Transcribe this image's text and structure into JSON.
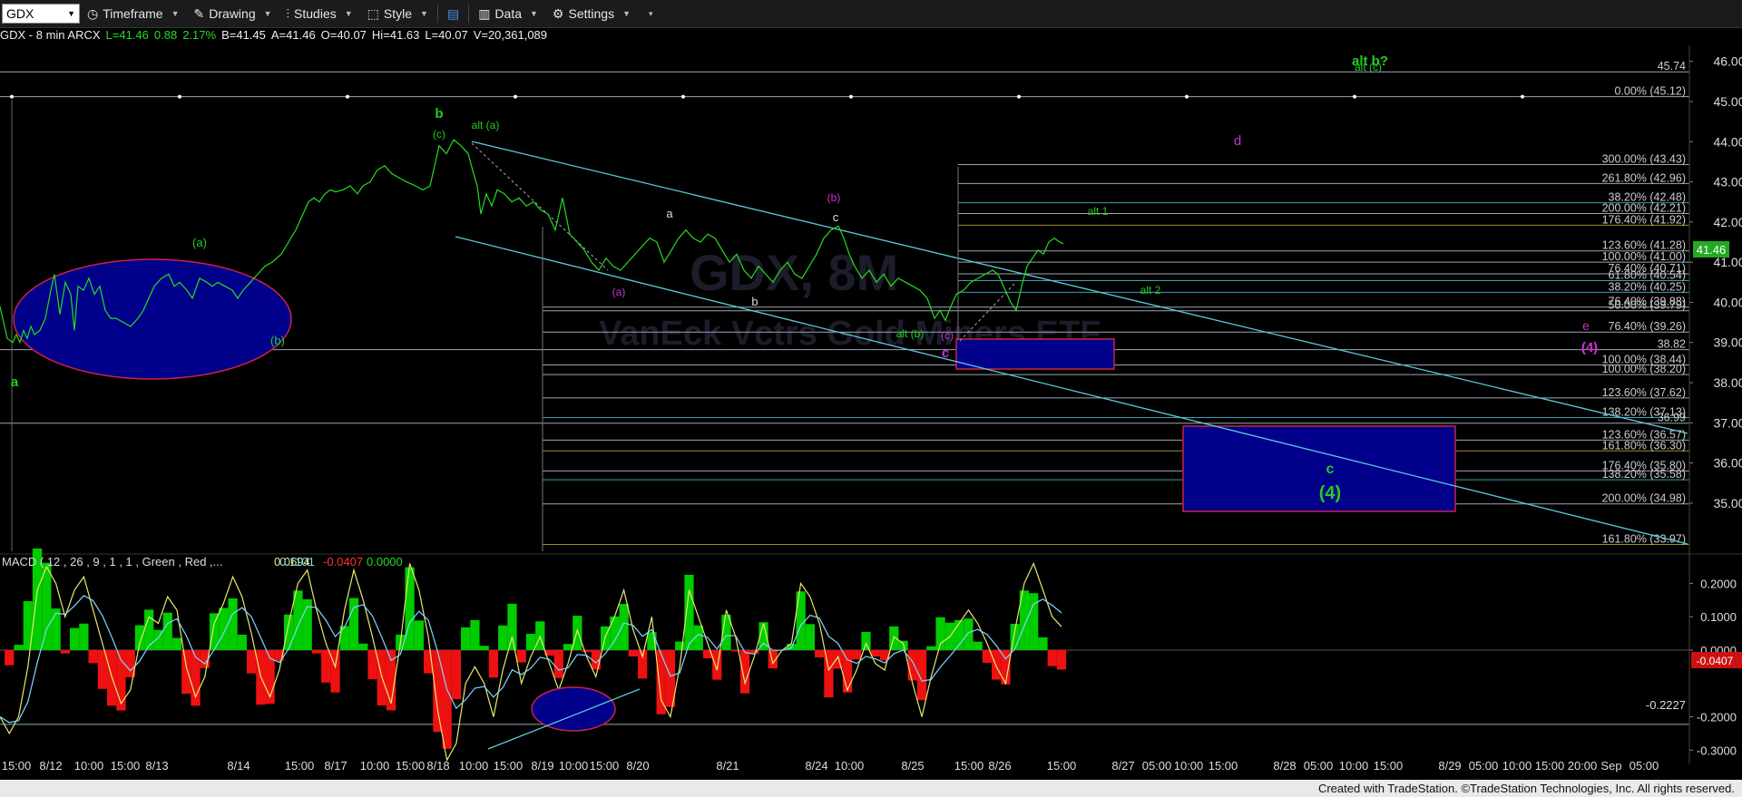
{
  "toolbar": {
    "symbol": "GDX",
    "timeframe_label": "Timeframe",
    "drawing_label": "Drawing",
    "studies_label": "Studies",
    "style_label": "Style",
    "data_label": "Data",
    "settings_label": "Settings"
  },
  "infobar": {
    "title": "GDX - 8 min ARCX",
    "last": "L=41.46",
    "change": "0.88",
    "pct": "2.17%",
    "bid": "B=41.45",
    "ask": "A=41.46",
    "open": "O=40.07",
    "high": "Hi=41.63",
    "low": "L=40.07",
    "volume": "V=20,361,089"
  },
  "macd_header": {
    "label": "MACD ( 12 , 26 , 9 , 1 , 1 , Green , Red ,...",
    "v1": "0.0694",
    "v2": "0.1101",
    "v3": "-0.0407",
    "v4": "0.0000"
  },
  "watermark": {
    "symbol": "GDX, 8M",
    "name": "VanEck Vctrs Gold Miners ETF"
  },
  "footer": "Created with TradeStation. ©TradeStation Technologies, Inc. All rights reserved.",
  "colors": {
    "price": "#22dd22",
    "green_label": "#22cc22",
    "magenta": "#cc33cc",
    "channel": "#5fc8dc",
    "box_fill": "#00008b",
    "box_border": "#cc2244",
    "macd_pos": "#00dd00",
    "macd_neg": "#ee1111",
    "macd_line": "#e8e870",
    "signal_line": "#7fd7ff"
  },
  "chart_data": [
    {
      "type": "line",
      "subtype": "candlestick-price",
      "symbol": "GDX",
      "interval": "8 min",
      "ylim": [
        33.8,
        46.4
      ],
      "y_ticks": [
        35.0,
        36.0,
        37.0,
        38.0,
        39.0,
        40.0,
        41.0,
        42.0,
        43.0,
        44.0,
        45.0,
        46.0
      ],
      "y_tick_labels": [
        "35.00",
        "36.00",
        "37.00",
        "38.00",
        "39.00",
        "40.00",
        "41.00",
        "42.00",
        "43.00",
        "44.00",
        "45.00",
        "46.00"
      ],
      "last_price": 41.46,
      "last_price_label": "41.46",
      "x_labels": [
        "15:00",
        "8/12",
        "10:00",
        "15:00",
        "8/13",
        "8/14",
        "15:00",
        "8/17",
        "10:00",
        "15:00",
        "8/18",
        "10:00",
        "15:00",
        "8/19",
        "10:00",
        "15:00",
        "8/20",
        "8/21",
        "8/24",
        "10:00",
        "8/25",
        "15:00",
        "8/26",
        "15:00",
        "8/27",
        "05:00",
        "10:00",
        "15:00",
        "8/28",
        "05:00",
        "10:00",
        "15:00",
        "8/29",
        "05:00",
        "10:00",
        "15:00",
        "20:00",
        "Sep",
        "05:00"
      ],
      "price_path": [
        [
          0,
          39.9
        ],
        [
          8,
          39.1
        ],
        [
          14,
          39.0
        ],
        [
          18,
          39.2
        ],
        [
          22,
          39.0
        ],
        [
          26,
          39.3
        ],
        [
          30,
          39.1
        ],
        [
          34,
          39.4
        ],
        [
          38,
          39.2
        ],
        [
          44,
          39.3
        ],
        [
          50,
          39.6
        ],
        [
          56,
          40.3
        ],
        [
          60,
          40.7
        ],
        [
          66,
          39.7
        ],
        [
          72,
          40.5
        ],
        [
          78,
          40.2
        ],
        [
          82,
          39.3
        ],
        [
          86,
          40.4
        ],
        [
          92,
          40.3
        ],
        [
          98,
          40.6
        ],
        [
          104,
          40.2
        ],
        [
          110,
          40.4
        ],
        [
          116,
          39.8
        ],
        [
          122,
          39.6
        ],
        [
          128,
          39.6
        ],
        [
          136,
          39.5
        ],
        [
          144,
          39.4
        ],
        [
          152,
          39.6
        ],
        [
          158,
          39.8
        ],
        [
          164,
          40.1
        ],
        [
          170,
          40.4
        ],
        [
          178,
          40.6
        ],
        [
          186,
          40.7
        ],
        [
          192,
          40.4
        ],
        [
          198,
          40.5
        ],
        [
          206,
          40.3
        ],
        [
          212,
          40.1
        ],
        [
          220,
          40.6
        ],
        [
          228,
          40.5
        ],
        [
          234,
          40.4
        ],
        [
          240,
          40.5
        ],
        [
          248,
          40.4
        ],
        [
          256,
          40.3
        ],
        [
          262,
          40.1
        ],
        [
          268,
          40.3
        ],
        [
          276,
          40.5
        ],
        [
          284,
          40.7
        ],
        [
          292,
          40.9
        ],
        [
          300,
          41.0
        ],
        [
          310,
          41.2
        ],
        [
          318,
          41.5
        ],
        [
          326,
          41.8
        ],
        [
          334,
          42.2
        ],
        [
          340,
          42.5
        ],
        [
          346,
          42.6
        ],
        [
          352,
          42.5
        ],
        [
          358,
          42.7
        ],
        [
          364,
          42.8
        ],
        [
          370,
          42.75
        ],
        [
          378,
          42.8
        ],
        [
          386,
          42.9
        ],
        [
          394,
          42.7
        ],
        [
          400,
          42.9
        ],
        [
          408,
          43.0
        ],
        [
          416,
          43.3
        ],
        [
          424,
          43.4
        ],
        [
          432,
          43.2
        ],
        [
          440,
          43.1
        ],
        [
          448,
          43.0
        ],
        [
          458,
          42.9
        ],
        [
          466,
          42.8
        ],
        [
          474,
          42.9
        ],
        [
          484,
          43.9
        ],
        [
          492,
          43.7
        ],
        [
          500,
          44.05
        ],
        [
          508,
          43.9
        ],
        [
          516,
          43.7
        ],
        [
          522,
          43.2
        ],
        [
          526,
          42.9
        ],
        [
          530,
          42.2
        ],
        [
          536,
          42.7
        ],
        [
          542,
          42.4
        ],
        [
          548,
          42.8
        ],
        [
          556,
          42.7
        ],
        [
          564,
          42.5
        ],
        [
          572,
          42.6
        ],
        [
          580,
          42.4
        ],
        [
          588,
          42.5
        ],
        [
          596,
          42.3
        ],
        [
          604,
          42.2
        ],
        [
          612,
          41.8
        ],
        [
          620,
          42.6
        ],
        [
          628,
          41.7
        ],
        [
          636,
          41.5
        ],
        [
          644,
          41.3
        ],
        [
          652,
          41.0
        ],
        [
          660,
          40.8
        ],
        [
          668,
          41.1
        ],
        [
          676,
          40.9
        ],
        [
          684,
          40.8
        ],
        [
          692,
          41.0
        ],
        [
          700,
          41.2
        ],
        [
          708,
          41.4
        ],
        [
          716,
          41.6
        ],
        [
          724,
          41.5
        ],
        [
          732,
          41.0
        ],
        [
          740,
          41.3
        ],
        [
          748,
          41.6
        ],
        [
          756,
          41.8
        ],
        [
          764,
          41.6
        ],
        [
          772,
          41.5
        ],
        [
          780,
          41.7
        ],
        [
          788,
          41.6
        ],
        [
          796,
          41.3
        ],
        [
          804,
          41.0
        ],
        [
          812,
          41.2
        ],
        [
          820,
          40.8
        ],
        [
          828,
          40.6
        ],
        [
          836,
          40.9
        ],
        [
          844,
          40.7
        ],
        [
          852,
          40.5
        ],
        [
          860,
          40.8
        ],
        [
          868,
          41.0
        ],
        [
          876,
          40.7
        ],
        [
          884,
          40.6
        ],
        [
          892,
          40.9
        ],
        [
          900,
          41.2
        ],
        [
          908,
          41.6
        ],
        [
          916,
          41.8
        ],
        [
          924,
          41.9
        ],
        [
          930,
          41.6
        ],
        [
          936,
          41.2
        ],
        [
          942,
          40.9
        ],
        [
          950,
          40.6
        ],
        [
          958,
          40.8
        ],
        [
          966,
          40.5
        ],
        [
          974,
          40.7
        ],
        [
          982,
          40.4
        ],
        [
          990,
          40.6
        ],
        [
          998,
          40.5
        ],
        [
          1006,
          40.4
        ],
        [
          1014,
          40.3
        ],
        [
          1022,
          40.1
        ],
        [
          1030,
          39.6
        ],
        [
          1036,
          39.8
        ],
        [
          1042,
          39.55
        ],
        [
          1048,
          39.9
        ],
        [
          1054,
          40.2
        ],
        [
          1062,
          40.3
        ],
        [
          1070,
          40.5
        ],
        [
          1078,
          40.6
        ],
        [
          1086,
          40.7
        ],
        [
          1094,
          40.8
        ],
        [
          1100,
          40.7
        ],
        [
          1108,
          40.3
        ],
        [
          1114,
          40.0
        ],
        [
          1120,
          39.8
        ],
        [
          1126,
          40.4
        ],
        [
          1132,
          40.9
        ],
        [
          1138,
          41.1
        ],
        [
          1144,
          41.3
        ],
        [
          1150,
          41.2
        ],
        [
          1156,
          41.5
        ],
        [
          1162,
          41.6
        ],
        [
          1168,
          41.5
        ],
        [
          1172,
          41.46
        ]
      ],
      "overlay_lines": [
        {
          "label": "45.74",
          "value": 45.74
        },
        {
          "label": "0.00% (45.12)",
          "value": 45.12
        },
        {
          "label": "300.00% (43.43)",
          "value": 43.43
        },
        {
          "label": "261.80% (42.96)",
          "value": 42.96
        },
        {
          "label": "38.20% (42.48)",
          "value": 42.48
        },
        {
          "label": "200.00% (42.21)",
          "value": 42.21
        },
        {
          "label": "176.40% (41.92)",
          "value": 41.92
        },
        {
          "label": "123.60% (41.28)",
          "value": 41.28
        },
        {
          "label": "100.00% (41.00)",
          "value": 41.0
        },
        {
          "label": "76.40% (40.71)",
          "value": 40.71
        },
        {
          "label": "61.80% (40.54)",
          "value": 40.54
        },
        {
          "label": "38.20% (40.25)",
          "value": 40.25
        },
        {
          "label": "76.40% (39.88)",
          "value": 39.88
        },
        {
          "label": "50.00% (39.79)",
          "value": 39.79
        },
        {
          "label": "76.40% (39.26)",
          "value": 39.26
        },
        {
          "label": "38.82",
          "value": 38.82
        },
        {
          "label": "100.00% (38.44)",
          "value": 38.44
        },
        {
          "label": "100.00% (38.20)",
          "value": 38.2
        },
        {
          "label": "123.60% (37.62)",
          "value": 37.62
        },
        {
          "label": "138.20% (37.13)",
          "value": 37.13
        },
        {
          "label": "36.99",
          "value": 36.99
        },
        {
          "label": "123.60% (36.57)",
          "value": 36.57
        },
        {
          "label": "161.80% (36.30)",
          "value": 36.3
        },
        {
          "label": "176.40% (35.80)",
          "value": 35.8
        },
        {
          "label": "138.20% (35.58)",
          "value": 35.58
        },
        {
          "label": "200.00% (34.98)",
          "value": 34.98
        },
        {
          "label": "161.80% (33.97)",
          "value": 33.97
        }
      ],
      "wave_labels": [
        {
          "text": "alt b?",
          "color": "green"
        },
        {
          "text": "alt (c)",
          "color": "green"
        },
        {
          "text": "b",
          "color": "green"
        },
        {
          "text": "(c)",
          "color": "green"
        },
        {
          "text": "alt (a)",
          "color": "green"
        },
        {
          "text": "(a)",
          "color": "green"
        },
        {
          "text": "(b)",
          "color": "green"
        },
        {
          "text": "a",
          "color": "green"
        },
        {
          "text": "a",
          "color": "white"
        },
        {
          "text": "b",
          "color": "white"
        },
        {
          "text": "c",
          "color": "white"
        },
        {
          "text": "(a)",
          "color": "magenta"
        },
        {
          "text": "(b)",
          "color": "magenta"
        },
        {
          "text": "(c)",
          "color": "magenta"
        },
        {
          "text": "c",
          "color": "magenta"
        },
        {
          "text": "d",
          "color": "magenta"
        },
        {
          "text": "e",
          "color": "magenta"
        },
        {
          "text": "(4)",
          "color": "magenta"
        },
        {
          "text": "alt (b)",
          "color": "green"
        },
        {
          "text": "alt 1",
          "color": "green"
        },
        {
          "text": "alt 2",
          "color": "green"
        },
        {
          "text": "c",
          "color": "green"
        },
        {
          "text": "(4)",
          "color": "green"
        }
      ]
    },
    {
      "type": "bar",
      "subtype": "macd",
      "title": "MACD",
      "params": [
        12,
        26,
        9,
        1,
        1
      ],
      "ylim": [
        -0.34,
        0.28
      ],
      "y_ticks": [
        0.2,
        0.1,
        0.0,
        -0.2,
        -0.3
      ],
      "y_tick_labels": [
        "0.2000",
        "0.1000",
        "0.0000",
        "-0.2000",
        "-0.3000"
      ],
      "current_value_label": "-0.0407",
      "reference_level": {
        "label": "-0.2227",
        "value": -0.2227
      },
      "macd_series": [
        -0.2,
        -0.25,
        -0.2,
        -0.05,
        0.18,
        0.25,
        0.2,
        0.1,
        0.18,
        0.22,
        0.12,
        0.02,
        -0.08,
        -0.16,
        -0.12,
        0.02,
        0.1,
        0.08,
        0.16,
        0.12,
        -0.05,
        -0.14,
        -0.08,
        0.08,
        0.14,
        0.22,
        0.16,
        0.05,
        -0.08,
        -0.14,
        -0.06,
        0.08,
        0.2,
        0.24,
        0.12,
        0.02,
        -0.05,
        0.12,
        0.24,
        0.15,
        0.04,
        -0.08,
        -0.16,
        0.02,
        0.26,
        0.18,
        0.04,
        -0.18,
        -0.33,
        -0.28,
        -0.1,
        -0.05,
        -0.1,
        -0.2,
        -0.06,
        0.04,
        -0.1,
        -0.02,
        0.04,
        -0.04,
        -0.12,
        -0.04,
        0.06,
        -0.02,
        -0.08,
        0.04,
        0.1,
        0.18,
        0.06,
        -0.02,
        0.1,
        -0.15,
        -0.2,
        -0.05,
        0.18,
        0.1,
        0.02,
        -0.06,
        0.12,
        0.04,
        -0.1,
        -0.02,
        0.08,
        -0.04,
        0.0,
        0.02,
        0.2,
        0.16,
        0.08,
        -0.06,
        -0.02,
        -0.12,
        -0.06,
        0.02,
        -0.04,
        -0.06,
        0.04,
        0.02,
        -0.1,
        -0.2,
        -0.08,
        0.02,
        0.04,
        0.08,
        0.12,
        0.08,
        0.02,
        -0.05,
        -0.1,
        0.06,
        0.2,
        0.26,
        0.18,
        0.1,
        0.07
      ]
    }
  ]
}
